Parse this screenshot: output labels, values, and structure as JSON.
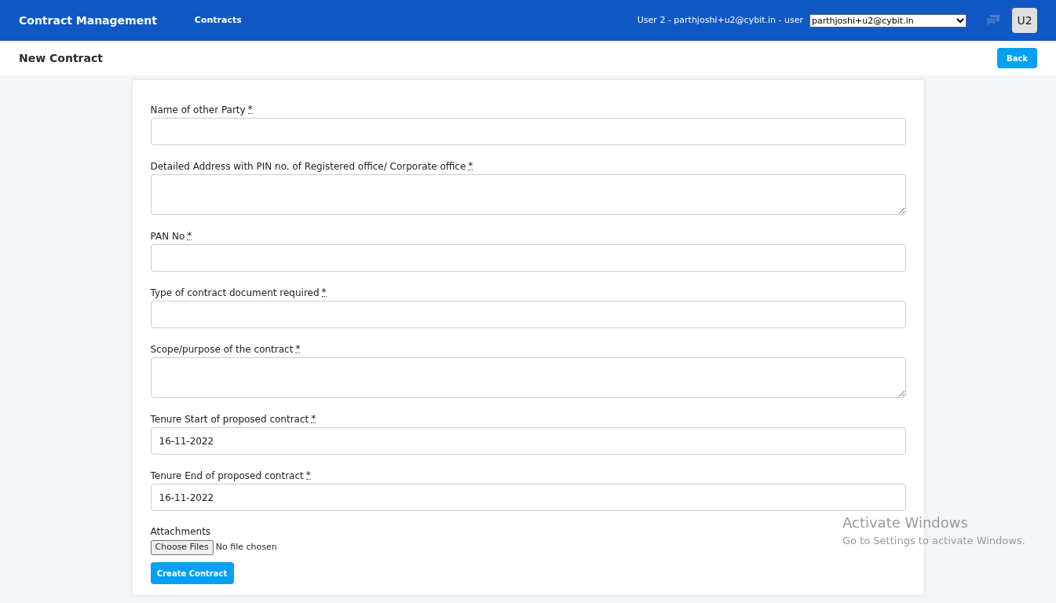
{
  "navbar": {
    "brand": "Contract Management",
    "links": [
      {
        "label": "Contracts"
      }
    ],
    "user_text": "User 2 - parthjoshi+u2@cybit.in - user",
    "user_select": {
      "value": "parthjoshi+u2@cybit.in"
    },
    "avatar": "U2"
  },
  "page_header": {
    "title": "New Contract",
    "back_button": "Back"
  },
  "form": {
    "fields": [
      {
        "kind": "input",
        "label": "Name of other Party",
        "required_mark": "*"
      },
      {
        "kind": "textarea",
        "label": "Detailed Address with PIN no. of Registered office/ Corporate office",
        "required_mark": "*"
      },
      {
        "kind": "input",
        "label": "PAN No",
        "required_mark": "*"
      },
      {
        "kind": "input",
        "label": "Type of contract document required",
        "required_mark": "*"
      },
      {
        "kind": "textarea",
        "label": "Scope/purpose of the contract",
        "required_mark": "*"
      },
      {
        "kind": "input",
        "label": "Tenure Start of proposed contract",
        "required_mark": "*",
        "value": "16-11-2022"
      },
      {
        "kind": "input",
        "label": "Tenure End of proposed contract",
        "required_mark": "*",
        "value": "16-11-2022"
      }
    ],
    "attachments": {
      "label": "Attachments",
      "button": "Choose Files",
      "status": "No file chosen"
    },
    "submit": "Create Contract"
  },
  "os_notice": {
    "title": "Activate Windows",
    "subtitle": "Go to Settings to activate Windows."
  }
}
